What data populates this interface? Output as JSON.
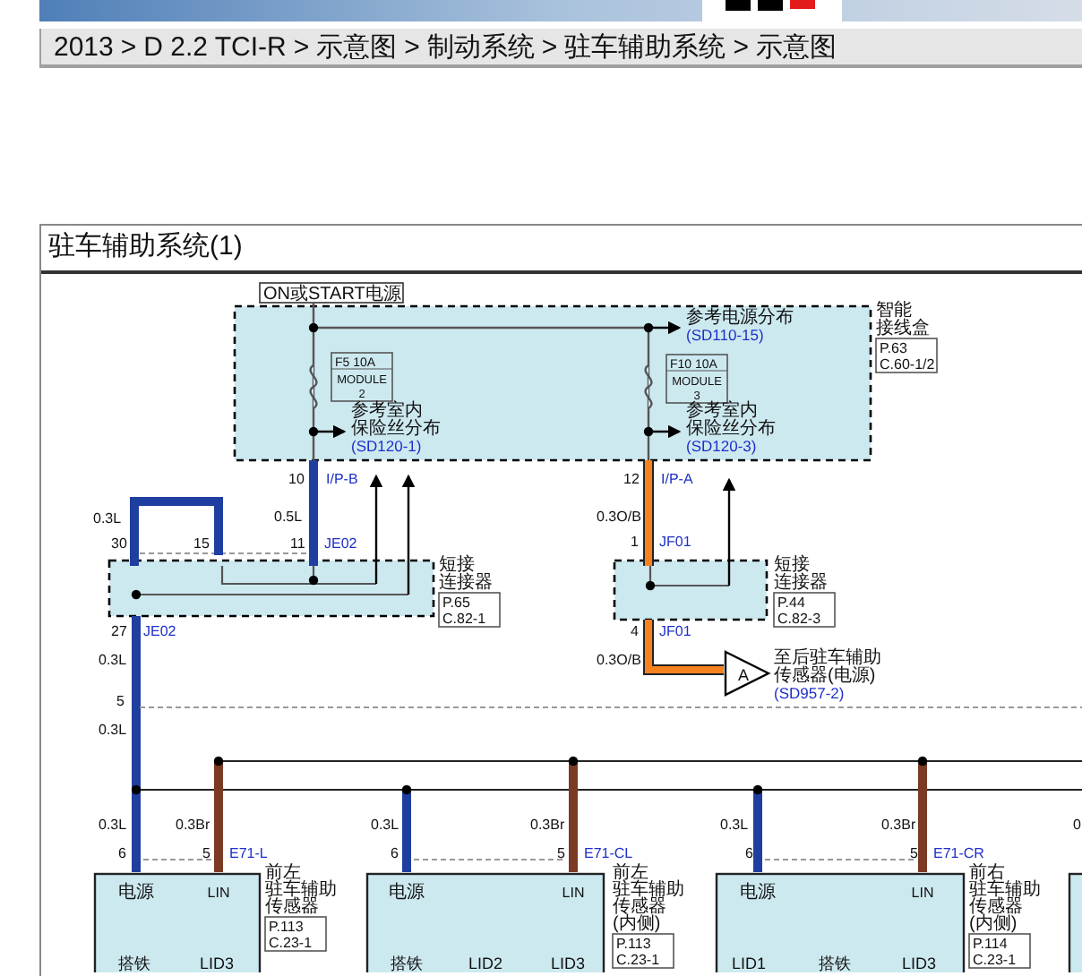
{
  "breadcrumb": {
    "separator": ">",
    "items": [
      "2013",
      "D 2.2 TCI-R",
      "示意图",
      "制动系统",
      "驻车辅助系统",
      "示意图"
    ]
  },
  "diagram": {
    "title": "驻车辅助系统(1)",
    "power_source": "ON或START电源",
    "fuses": [
      {
        "rating": "F5 10A",
        "module": "MODULE",
        "number": "2"
      },
      {
        "rating": "F10 10A",
        "module": "MODULE",
        "number": "3"
      }
    ],
    "references": [
      {
        "lines": [
          "参考电源分布"
        ],
        "code": "(SD110-15)"
      },
      {
        "lines": [
          "参考室内",
          "保险丝分布"
        ],
        "code": "(SD120-1)"
      },
      {
        "lines": [
          "参考室内",
          "保险丝分布"
        ],
        "code": "(SD120-3)"
      },
      {
        "lines": [
          "至后驻车辅助",
          "传感器(电源)"
        ],
        "code": "(SD957-2)",
        "marker": "A"
      }
    ],
    "components": [
      {
        "lines": [
          "智能",
          "接线盒"
        ],
        "page": "P.63",
        "connector": "C.60-1/2"
      },
      {
        "lines": [
          "短接",
          "连接器"
        ],
        "page": "P.65",
        "connector": "C.82-1"
      },
      {
        "lines": [
          "短接",
          "连接器"
        ],
        "page": "P.44",
        "connector": "C.82-3"
      }
    ],
    "wire_labels": [
      {
        "text": "10",
        "kind": "pin"
      },
      {
        "text": "I/P-B",
        "kind": "connector"
      },
      {
        "text": "0.5L",
        "kind": "gauge"
      },
      {
        "text": "11",
        "kind": "pin"
      },
      {
        "text": "JE02",
        "kind": "connector"
      },
      {
        "text": "0.3L",
        "kind": "gauge"
      },
      {
        "text": "30",
        "kind": "pin"
      },
      {
        "text": "15",
        "kind": "pin"
      },
      {
        "text": "27",
        "kind": "pin"
      },
      {
        "text": "JE02",
        "kind": "connector"
      },
      {
        "text": "0.3L",
        "kind": "gauge"
      },
      {
        "text": "5",
        "kind": "pin"
      },
      {
        "text": "0.3L",
        "kind": "gauge"
      },
      {
        "text": "12",
        "kind": "pin"
      },
      {
        "text": "I/P-A",
        "kind": "connector"
      },
      {
        "text": "0.3O/B",
        "kind": "gauge"
      },
      {
        "text": "1",
        "kind": "pin"
      },
      {
        "text": "JF01",
        "kind": "connector"
      },
      {
        "text": "4",
        "kind": "pin"
      },
      {
        "text": "JF01",
        "kind": "connector"
      },
      {
        "text": "0.3O/B",
        "kind": "gauge"
      },
      {
        "text": "0.3L",
        "kind": "gauge"
      },
      {
        "text": "0.3Br",
        "kind": "gauge"
      },
      {
        "text": "6",
        "kind": "pin"
      },
      {
        "text": "5",
        "kind": "pin"
      },
      {
        "text": "E71-L",
        "kind": "connector"
      },
      {
        "text": "0.3L",
        "kind": "gauge"
      },
      {
        "text": "0.3Br",
        "kind": "gauge"
      },
      {
        "text": "6",
        "kind": "pin"
      },
      {
        "text": "5",
        "kind": "pin"
      },
      {
        "text": "E71-CL",
        "kind": "connector"
      },
      {
        "text": "0.3L",
        "kind": "gauge"
      },
      {
        "text": "0.3Br",
        "kind": "gauge"
      },
      {
        "text": "6",
        "kind": "pin"
      },
      {
        "text": "5",
        "kind": "pin"
      },
      {
        "text": "E71-CR",
        "kind": "connector"
      },
      {
        "text": "0",
        "kind": "gauge"
      }
    ],
    "sensors": [
      {
        "pins_top": [
          "电源",
          "LIN"
        ],
        "pins_bottom": [
          "搭铁",
          "LID3"
        ],
        "name_lines": [
          "前左",
          "驻车辅助",
          "传感器"
        ],
        "page": "P.113",
        "connector": "C.23-1"
      },
      {
        "pins_top": [
          "电源",
          "LIN"
        ],
        "pins_bottom": [
          "搭铁",
          "LID2",
          "LID3"
        ],
        "name_lines": [
          "前左",
          "驻车辅助",
          "传感器",
          "(内侧)"
        ],
        "page": "P.113",
        "connector": "C.23-1"
      },
      {
        "pins_top": [
          "电源",
          "LIN"
        ],
        "pins_bottom": [
          "LID1",
          "搭铁",
          "LID3"
        ],
        "name_lines": [
          "前右",
          "驻车辅助",
          "传感器",
          "(内侧)"
        ],
        "page": "P.114",
        "connector": "C.23-1"
      }
    ]
  }
}
